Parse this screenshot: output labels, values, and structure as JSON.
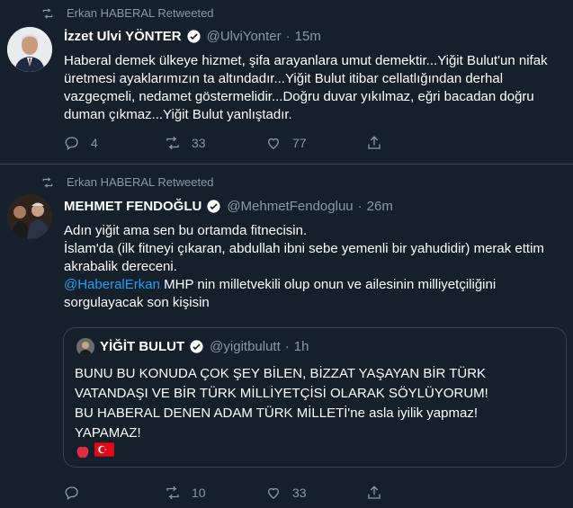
{
  "tweets": [
    {
      "retweet_label": "Erkan HABERAL Retweeted",
      "name": "İzzet Ulvi YÖNTER",
      "handle": "@UlviYonter",
      "time": "15m",
      "text": "Haberal demek ülkeye hizmet, şifa arayanlara umut demektir...Yiğit Bulut'un nifak üretmesi ayaklarımızın ta altındadır...Yiğit Bulut itibar cellatlığından derhal vazgeçmeli, nedamet göstermelidir...Doğru duvar yıkılmaz, eğri bacadan doğru duman çıkmaz...Yiğit Bulut yanlıştadır.",
      "replies": "4",
      "retweets": "33",
      "likes": "77"
    },
    {
      "retweet_label": "Erkan HABERAL Retweeted",
      "name": "MEHMET FENDOĞLU",
      "handle": "@MehmetFendogluu",
      "time": "26m",
      "text_line1": "Adın yiğit ama sen bu ortamda fitnecisin.",
      "text_line2": " İslam'da (ilk fitneyi çıkaran, abdullah ibni sebe yemenli bir yahudidir) merak ettim akrabalik dereceni.",
      "mention": "@HaberalErkan",
      "text_line3": " MHP nin milletvekili olup onun ve ailesinin milliyetçiliğini sorgulayacak son kişisin",
      "replies": "",
      "retweets": "10",
      "likes": "33",
      "quote": {
        "name": "YİĞİT BULUT",
        "handle": "@yigitbulutt",
        "time": "1h",
        "text": "BUNU BU KONUDA ÇOK ŞEY BİLEN, BİZZAT YAŞAYAN BİR TÜRK VATANDAŞI VE BİR TÜRK MİLLİYETÇİSİ OLARAK SÖYLÜYORUM!\nBU HABERAL DENEN ADAM TÜRK MİLLETİ'ne asla iyilik yapmaz!\nYAPAMAZ!",
        "emojis": [
          "apple-emoji",
          "turkey-flag-emoji"
        ]
      }
    }
  ],
  "colors": {
    "background": "#15202b",
    "muted": "#8899a6",
    "link": "#1da1f2",
    "border": "#38444d"
  }
}
